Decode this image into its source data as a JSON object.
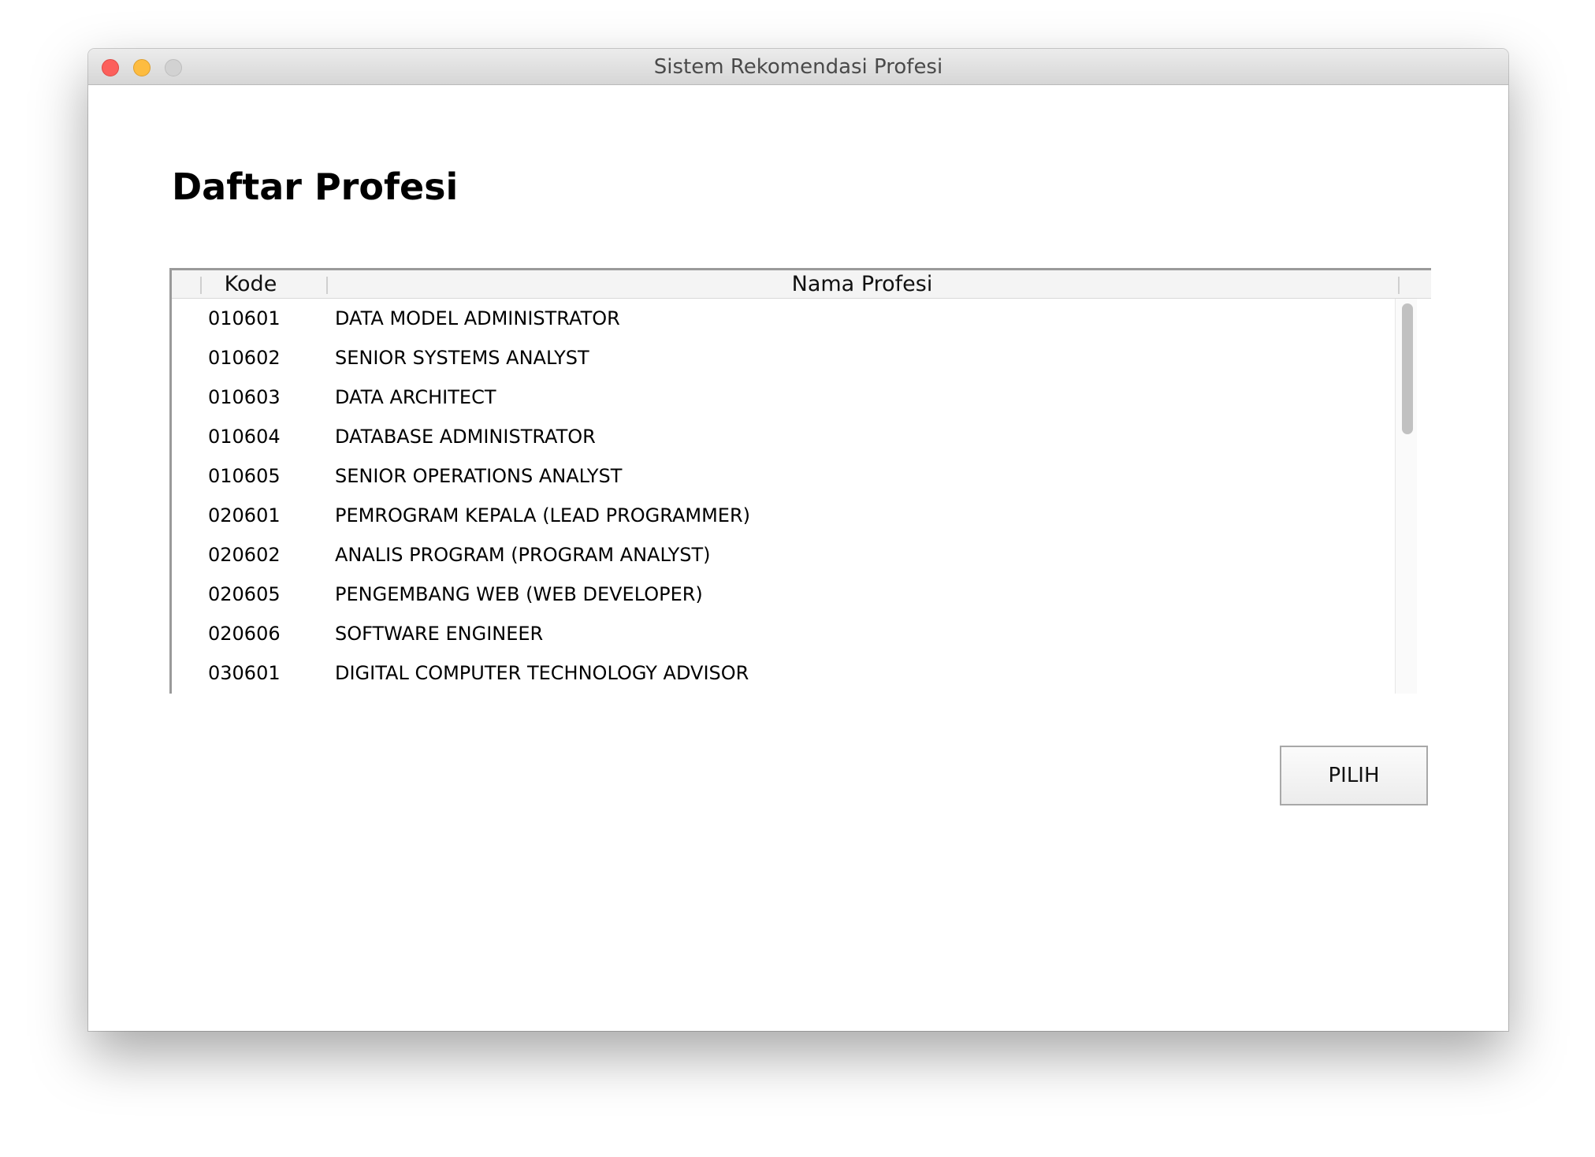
{
  "window": {
    "title": "Sistem Rekomendasi Profesi"
  },
  "page": {
    "title": "Daftar Profesi"
  },
  "table": {
    "columns": [
      "Kode",
      "Nama Profesi"
    ],
    "rows": [
      {
        "kode": "010601",
        "nama": "DATA MODEL ADMINISTRATOR"
      },
      {
        "kode": "010602",
        "nama": "SENIOR SYSTEMS ANALYST"
      },
      {
        "kode": "010603",
        "nama": "DATA ARCHITECT"
      },
      {
        "kode": "010604",
        "nama": "DATABASE ADMINISTRATOR"
      },
      {
        "kode": "010605",
        "nama": "SENIOR OPERATIONS ANALYST"
      },
      {
        "kode": "020601",
        "nama": "PEMROGRAM KEPALA (LEAD PROGRAMMER)"
      },
      {
        "kode": "020602",
        "nama": "ANALIS PROGRAM (PROGRAM ANALYST)"
      },
      {
        "kode": "020605",
        "nama": "PENGEMBANG WEB (WEB DEVELOPER)"
      },
      {
        "kode": "020606",
        "nama": "SOFTWARE ENGINEER"
      },
      {
        "kode": "030601",
        "nama": "DIGITAL COMPUTER TECHNOLOGY ADVISOR"
      }
    ]
  },
  "actions": {
    "pilih_label": "PILIH"
  },
  "colors": {
    "close": "#fc605c",
    "minimize": "#fdbc40",
    "zoom": "#d2d2d2"
  }
}
